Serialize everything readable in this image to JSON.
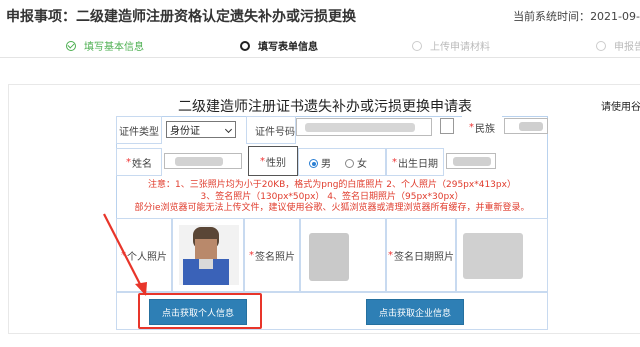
{
  "header": {
    "title": "申报事项：二级建造师注册资格认定遗失补办或污损更换",
    "time_label": "当前系统时间：",
    "time_value": "2021-09-"
  },
  "steps": [
    {
      "label": "填写基本信息",
      "state": "done"
    },
    {
      "label": "填写表单信息",
      "state": "current"
    },
    {
      "label": "上传申请材料",
      "state": "pending"
    },
    {
      "label": "申报告",
      "state": "pending"
    }
  ],
  "form": {
    "title": "二级建造师注册证书遗失补办或污损更换申请表",
    "help": "请使用谷",
    "id_type_label": "证件类型",
    "id_type_value": "身份证",
    "id_number_label": "证件号码",
    "ethnic_label": "民族",
    "name_label": "姓名",
    "gender_label": "性别",
    "gender_options": [
      "男",
      "女"
    ],
    "gender_selected": "男",
    "birth_label": "出生日期",
    "notes": [
      "注意：1、三张照片均为小于20KB，格式为png的白底照片    2、个人照片（295px*413px）",
      "3、签名照片（130px*50px）    4、签名日期照片（95px*30px）",
      "部分ie浏览器可能无法上传文件，建议使用谷歌、火狐浏览器或清理浏览器所有缓存，并重新登录。"
    ],
    "personal_photo_label": "个人照片",
    "signature_photo_label": "签名照片",
    "signature_date_photo_label": "签名日期照片",
    "btn_personal": "点击获取个人信息",
    "btn_company": "点击获取企业信息"
  },
  "colors": {
    "accent": "#2e7fb5",
    "highlight": "#e8352a",
    "done": "#4caf50",
    "note": "#e03c2d"
  }
}
